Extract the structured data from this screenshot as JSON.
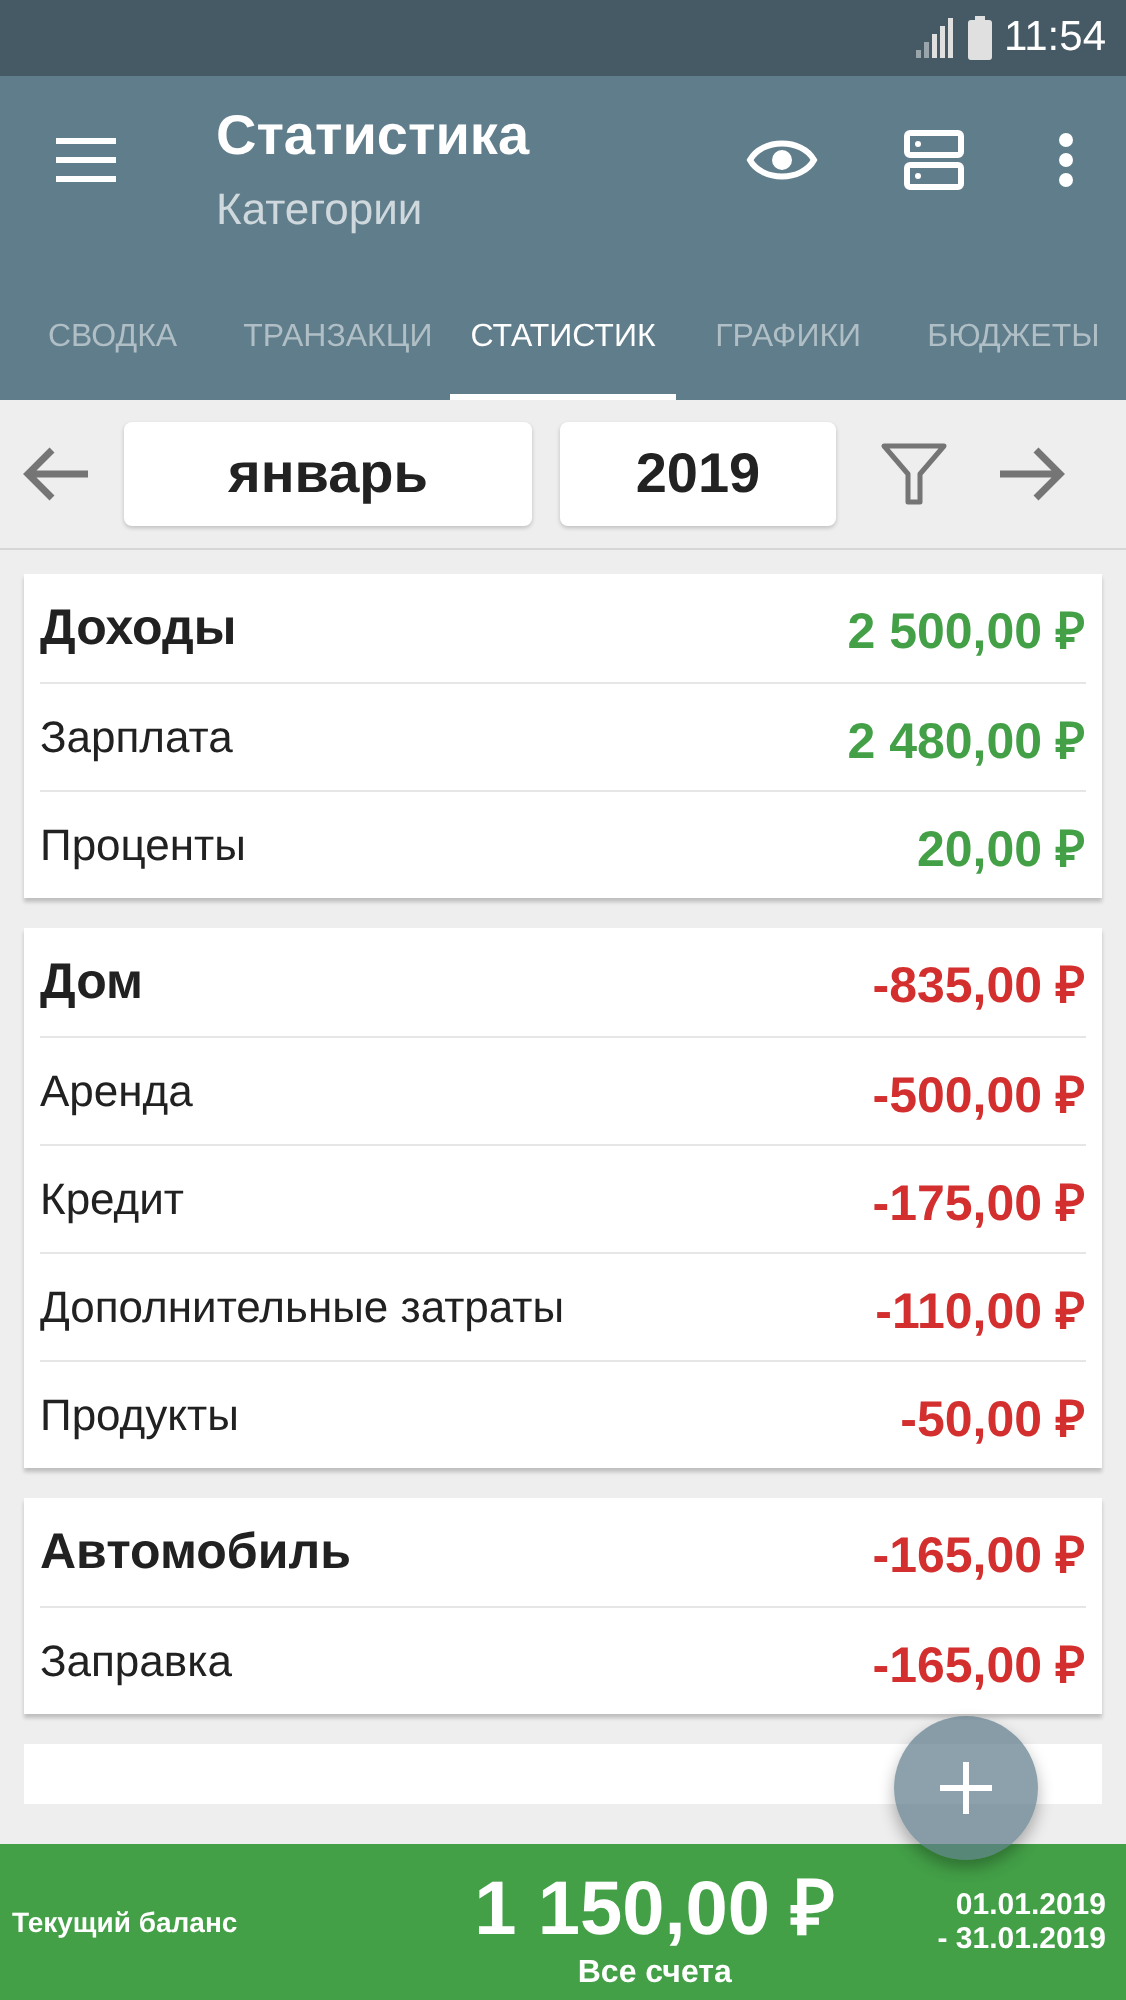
{
  "status_bar": {
    "time": "11:54"
  },
  "toolbar": {
    "title": "Статистика",
    "subtitle": "Категории"
  },
  "tabs": [
    {
      "label": "СВОДКА",
      "selected": false
    },
    {
      "label": "ТРАНЗАКЦИ",
      "selected": false
    },
    {
      "label": "СТАТИСТИК",
      "selected": true
    },
    {
      "label": "ГРАФИКИ",
      "selected": false
    },
    {
      "label": "БЮДЖЕТЫ",
      "selected": false
    }
  ],
  "period": {
    "month": "январь",
    "year": "2019"
  },
  "groups": [
    {
      "kind": "income",
      "name": "Доходы",
      "total": "2 500,00 ₽",
      "items": [
        {
          "name": "Зарплата",
          "amount": "2 480,00 ₽"
        },
        {
          "name": "Проценты",
          "amount": "20,00 ₽"
        }
      ]
    },
    {
      "kind": "expense",
      "name": "Дом",
      "total": "-835,00 ₽",
      "items": [
        {
          "name": "Аренда",
          "amount": "-500,00 ₽"
        },
        {
          "name": "Кредит",
          "amount": "-175,00 ₽"
        },
        {
          "name": "Дополнительные затраты",
          "amount": "-110,00 ₽"
        },
        {
          "name": "Продукты",
          "amount": "-50,00 ₽"
        }
      ]
    },
    {
      "kind": "expense",
      "name": "Автомобиль",
      "total": "-165,00 ₽",
      "items": [
        {
          "name": "Заправка",
          "amount": "-165,00 ₽"
        }
      ]
    }
  ],
  "footer": {
    "label": "Текущий баланс",
    "balance": "1 150,00 ₽",
    "accounts": "Все счета",
    "date_from": "01.01.2019",
    "date_to": "- 31.01.2019"
  }
}
